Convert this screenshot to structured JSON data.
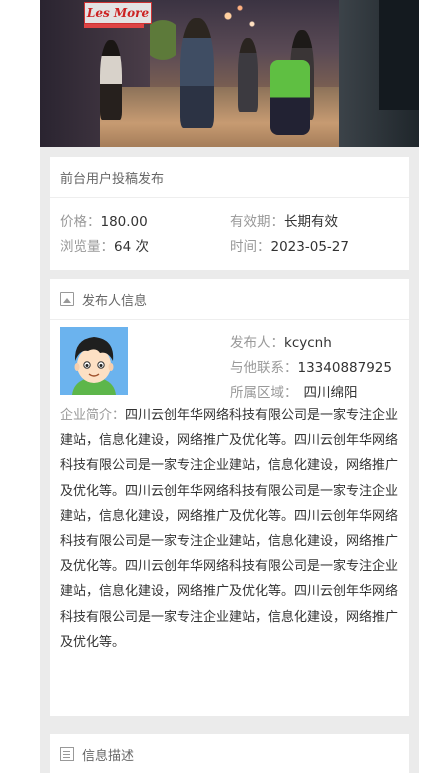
{
  "hero": {
    "sign_text": "Les More"
  },
  "summary": {
    "title": "前台用户投稿发布",
    "price_label": "价格：",
    "price_value": "180.00",
    "validity_label": "有效期：",
    "validity_value": "长期有效",
    "views_label": "浏览量：",
    "views_value": "64 次",
    "time_label": "时间：",
    "time_value": "2023-05-27"
  },
  "publisher": {
    "title": "发布人信息",
    "title_icon": "image-icon",
    "name_label": "发布人：",
    "name_value": "kcycnh",
    "contact_label": "与他联系：",
    "contact_value": "13340887925",
    "region_label": "所属区域：",
    "region_value": "四川绵阳",
    "intro_label": "企业简介：",
    "intro_text": "四川云创年华网络科技有限公司是一家专注企业建站，信息化建设，网络推广及优化等。四川云创年华网络科技有限公司是一家专注企业建站，信息化建设，网络推广及优化等。四川云创年华网络科技有限公司是一家专注企业建站，信息化建设，网络推广及优化等。四川云创年华网络科技有限公司是一家专注企业建站，信息化建设，网络推广及优化等。四川云创年华网络科技有限公司是一家专注企业建站，信息化建设，网络推广及优化等。四川云创年华网络科技有限公司是一家专注企业建站，信息化建设，网络推广及优化等。"
  },
  "description": {
    "title": "信息描述",
    "title_icon": "document-icon"
  },
  "colors": {
    "avatar_bg": "#6bb3ee",
    "page_bg": "#ebebeb"
  }
}
